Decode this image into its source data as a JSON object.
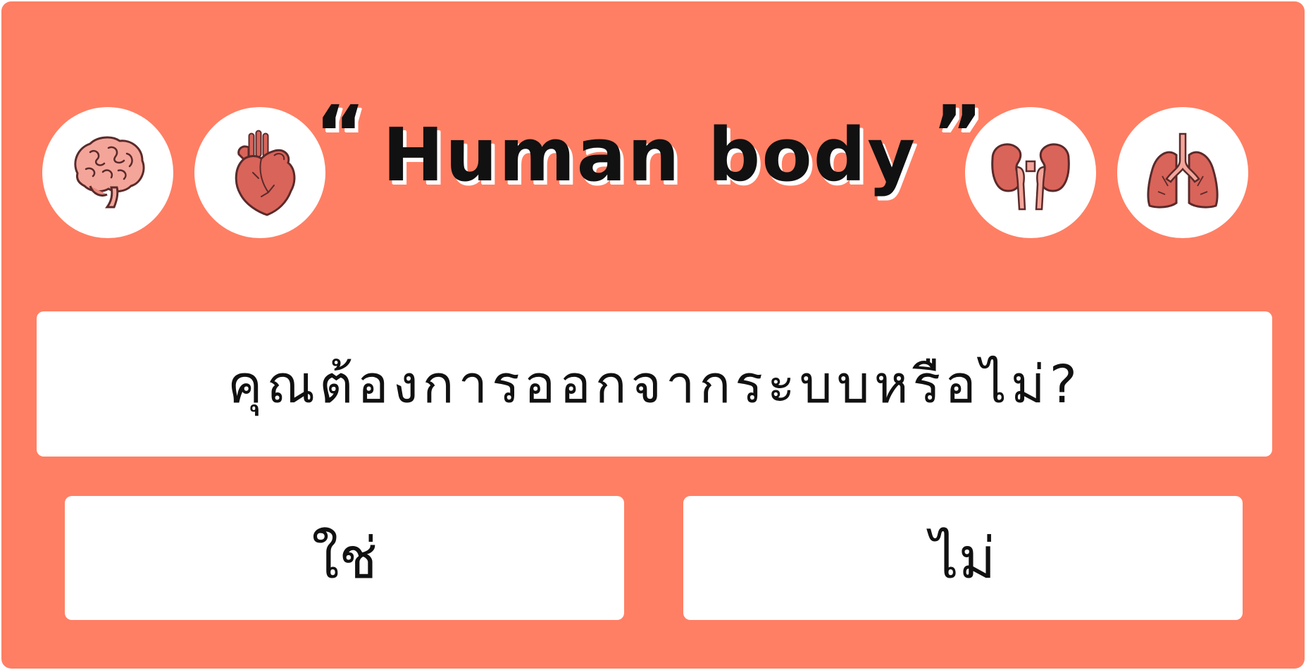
{
  "dialog": {
    "title": "Human body",
    "title_open_quote": "“",
    "title_close_quote": "”",
    "question": "คุณต้องการออกจากระบบหรือไม่?",
    "buttons": {
      "yes_label": "ใช่",
      "no_label": "ไม่"
    },
    "icons": [
      "brain-icon",
      "heart-icon",
      "kidneys-icon",
      "lungs-icon"
    ]
  },
  "colors": {
    "background": "#FF7F64",
    "panel": "#FFFFFF",
    "text": "#111111",
    "organ_fill": "#D9645A",
    "organ_light": "#F4A59A",
    "organ_stroke": "#5A2A2A"
  }
}
